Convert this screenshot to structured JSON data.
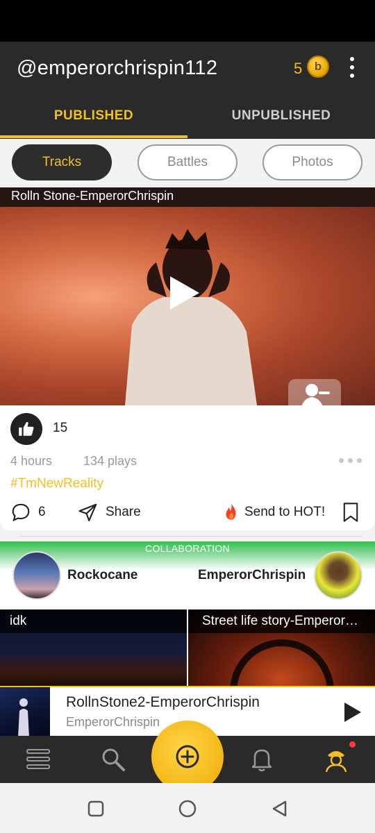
{
  "header": {
    "username": "@emperorchrispin112",
    "coin_count": "5",
    "coin_symbol": "b"
  },
  "tabs": [
    {
      "label": "PUBLISHED",
      "active": true
    },
    {
      "label": "UNPUBLISHED",
      "active": false
    }
  ],
  "filters": [
    {
      "label": "Tracks",
      "active": true
    },
    {
      "label": "Battles",
      "active": false
    },
    {
      "label": "Photos",
      "active": false
    }
  ],
  "track": {
    "title": "Rolln Stone-EmperorChrispin",
    "likes": "15",
    "time": "4 hours",
    "plays": "134 plays",
    "hashtag": "#TmNewReality",
    "comments": "6",
    "share_label": "Share",
    "hot_label": "Send to HOT!"
  },
  "collaboration": {
    "header": "COLLABORATION",
    "left_user": "Rockocane",
    "right_user": "EmperorChrispin"
  },
  "grid": [
    {
      "title": "idk"
    },
    {
      "title": "Street life story-EmperorChrispin"
    }
  ],
  "mini_player": {
    "title": "RollnStone2-EmperorChrispin",
    "artist": "EmperorChrispin"
  },
  "colors": {
    "accent": "#f3c023",
    "header_bg": "#2a2a2a",
    "hot": "#ff3b1f",
    "collab_green": "#2fbf4a"
  }
}
